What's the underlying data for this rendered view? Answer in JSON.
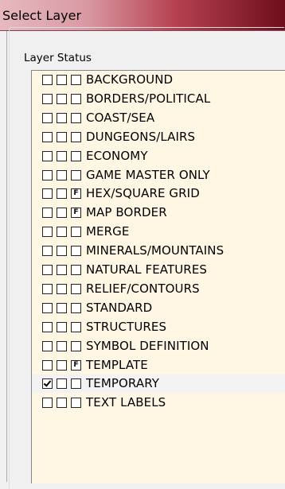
{
  "window": {
    "title": "Select Layer"
  },
  "group": {
    "label": "Layer Status"
  },
  "layers": [
    {
      "name": "BACKGROUND",
      "c1": false,
      "c2": "",
      "c3": ""
    },
    {
      "name": "BORDERS/POLITICAL",
      "c1": false,
      "c2": "",
      "c3": ""
    },
    {
      "name": "COAST/SEA",
      "c1": false,
      "c2": "",
      "c3": ""
    },
    {
      "name": "DUNGEONS/LAIRS",
      "c1": false,
      "c2": "",
      "c3": ""
    },
    {
      "name": "ECONOMY",
      "c1": false,
      "c2": "",
      "c3": ""
    },
    {
      "name": "GAME MASTER ONLY",
      "c1": false,
      "c2": "",
      "c3": ""
    },
    {
      "name": "HEX/SQUARE GRID",
      "c1": false,
      "c2": "",
      "c3": "F"
    },
    {
      "name": "MAP BORDER",
      "c1": false,
      "c2": "",
      "c3": "F"
    },
    {
      "name": "MERGE",
      "c1": false,
      "c2": "",
      "c3": ""
    },
    {
      "name": "MINERALS/MOUNTAINS",
      "c1": false,
      "c2": "",
      "c3": ""
    },
    {
      "name": "NATURAL FEATURES",
      "c1": false,
      "c2": "",
      "c3": ""
    },
    {
      "name": "RELIEF/CONTOURS",
      "c1": false,
      "c2": "",
      "c3": ""
    },
    {
      "name": "STANDARD",
      "c1": false,
      "c2": "",
      "c3": ""
    },
    {
      "name": "STRUCTURES",
      "c1": false,
      "c2": "",
      "c3": ""
    },
    {
      "name": "SYMBOL DEFINITION",
      "c1": false,
      "c2": "",
      "c3": ""
    },
    {
      "name": "TEMPLATE",
      "c1": false,
      "c2": "",
      "c3": "F"
    },
    {
      "name": "TEMPORARY",
      "c1": true,
      "c2": "",
      "c3": "",
      "highlighted": true
    },
    {
      "name": "TEXT LABELS",
      "c1": false,
      "c2": "",
      "c3": ""
    }
  ]
}
